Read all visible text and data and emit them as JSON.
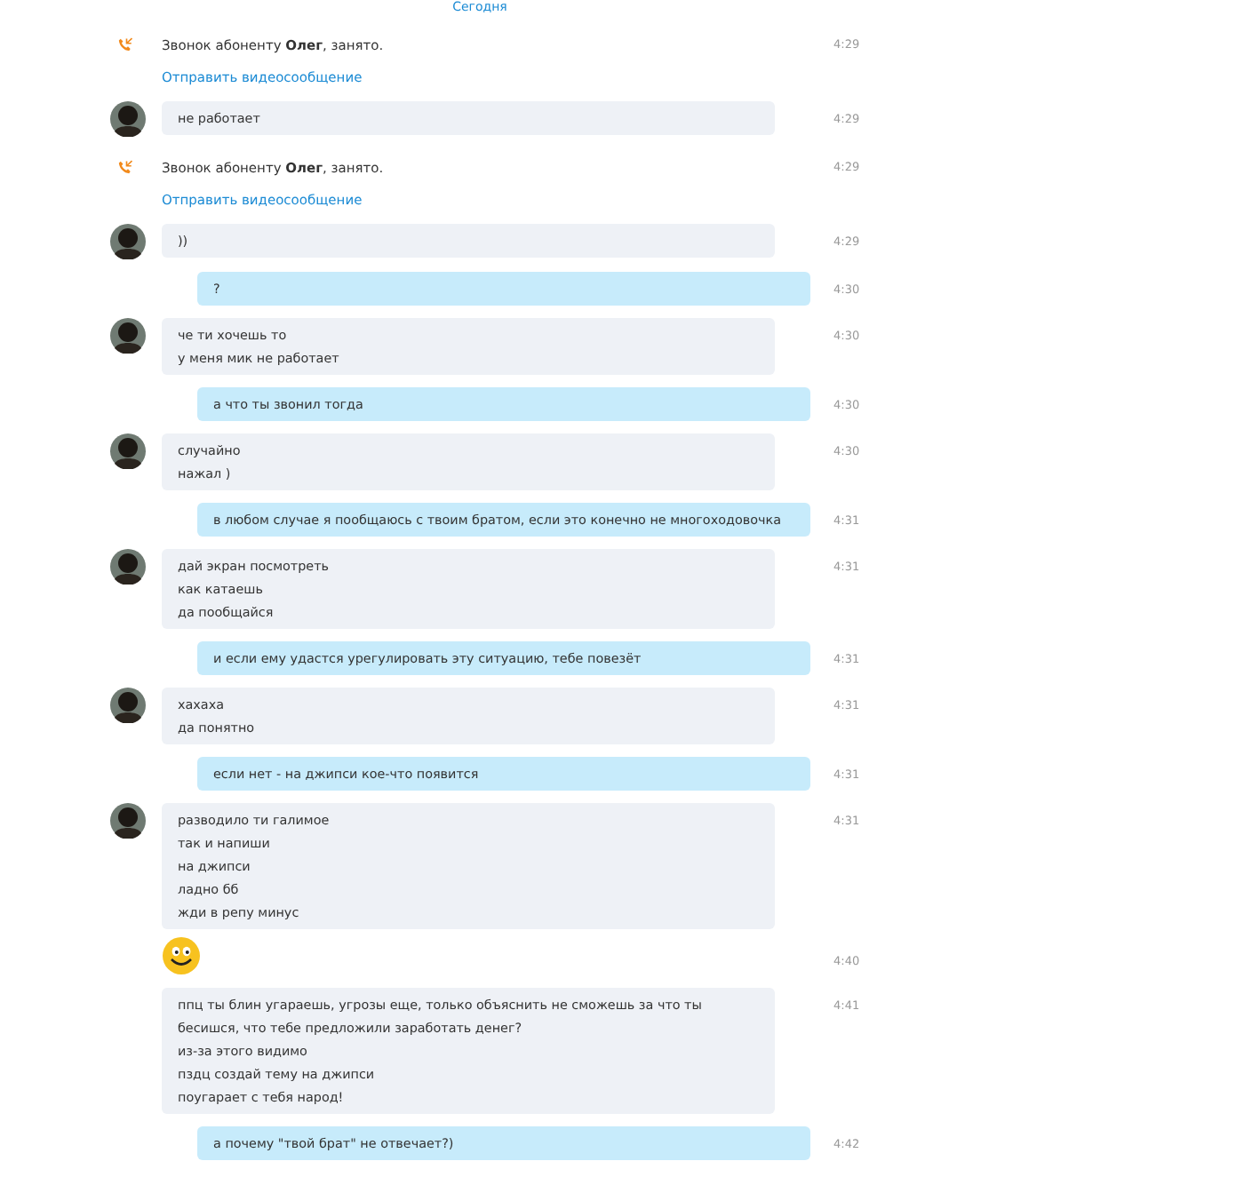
{
  "date_separator": "Сегодня",
  "messages": [
    {
      "kind": "call",
      "text": "Звонок абоненту **Олег**, занято.",
      "link": "Отправить видеосообщение",
      "time": "4:29"
    },
    {
      "kind": "incoming",
      "lines": [
        "не работает"
      ],
      "time": "4:29"
    },
    {
      "kind": "call",
      "text": "Звонок абоненту **Олег**, занято.",
      "link": "Отправить видеосообщение",
      "time": "4:29"
    },
    {
      "kind": "incoming",
      "lines": [
        "))"
      ],
      "time": "4:29"
    },
    {
      "kind": "outgoing",
      "lines": [
        "?"
      ],
      "time": "4:30"
    },
    {
      "kind": "incoming",
      "lines": [
        "че ти хочешь то",
        "у меня мик не работает"
      ],
      "time": "4:30"
    },
    {
      "kind": "outgoing",
      "lines": [
        "а что ты звонил тогда"
      ],
      "time": "4:30"
    },
    {
      "kind": "incoming",
      "lines": [
        "случайно",
        "нажал )"
      ],
      "time": "4:30"
    },
    {
      "kind": "outgoing",
      "lines": [
        "в любом случае я пообщаюсь с твоим братом, если это конечно не многоходовочка"
      ],
      "time": "4:31"
    },
    {
      "kind": "incoming",
      "lines": [
        "дай экран посмотреть",
        "как катаешь",
        "да пообщайся"
      ],
      "time": "4:31"
    },
    {
      "kind": "outgoing",
      "lines": [
        "и если ему удастся урегулировать эту ситуацию, тебе повезёт"
      ],
      "time": "4:31"
    },
    {
      "kind": "incoming",
      "lines": [
        "хахаха",
        "да понятно"
      ],
      "time": "4:31"
    },
    {
      "kind": "outgoing",
      "lines": [
        "если нет - на джипси кое-что появится"
      ],
      "time": "4:31"
    },
    {
      "kind": "incoming",
      "lines": [
        "разводило ти галимое",
        "так и напиши",
        "на джипси",
        "ладно бб",
        "жди в репу минус"
      ],
      "time": "4:31"
    },
    {
      "kind": "emoji",
      "time": "4:40"
    },
    {
      "kind": "incoming_cont",
      "lines": [
        "ппц ты блин угараешь, угрозы еще, только объяснить не сможешь за что ты бесишся, что тебе предложили заработать денег?",
        "из-за этого видимо",
        "пздц создай тему на джипси",
        "поугарает с тебя народ!"
      ],
      "time": "4:41"
    },
    {
      "kind": "outgoing",
      "lines": [
        "а почему \"твой брат\" не отвечает?)"
      ],
      "time": "4:42"
    }
  ]
}
